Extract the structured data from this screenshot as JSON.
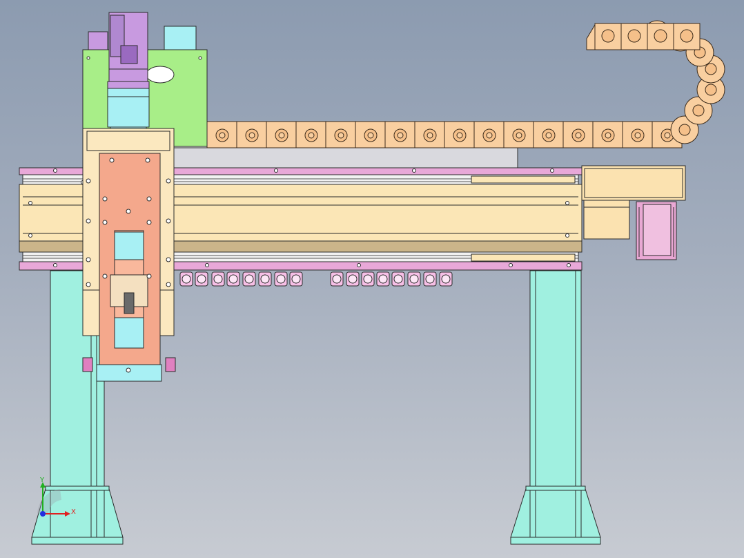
{
  "viewport": {
    "background_top": "#8c9bb0",
    "background_bottom": "#c7cbd2"
  },
  "triad": {
    "x_label": "X",
    "y_label": "Y",
    "x_color": "#e02020",
    "y_color": "#20b020",
    "z_color": "#2030e0"
  },
  "colors": {
    "column": "#a0f0e0",
    "beam_body": "#fbe6b6",
    "rail_pink": "#e8a8d8",
    "carriage_plate": "#fbe8bf",
    "z_plate": "#f4a88c",
    "motor": "#c89ae0",
    "motor_mount": "#a8ee88",
    "coupling": "#a8f0f4",
    "cable_chain": "#f9cfa0",
    "end_block": "#fbe2b0",
    "clip": "#f6bfe6"
  }
}
